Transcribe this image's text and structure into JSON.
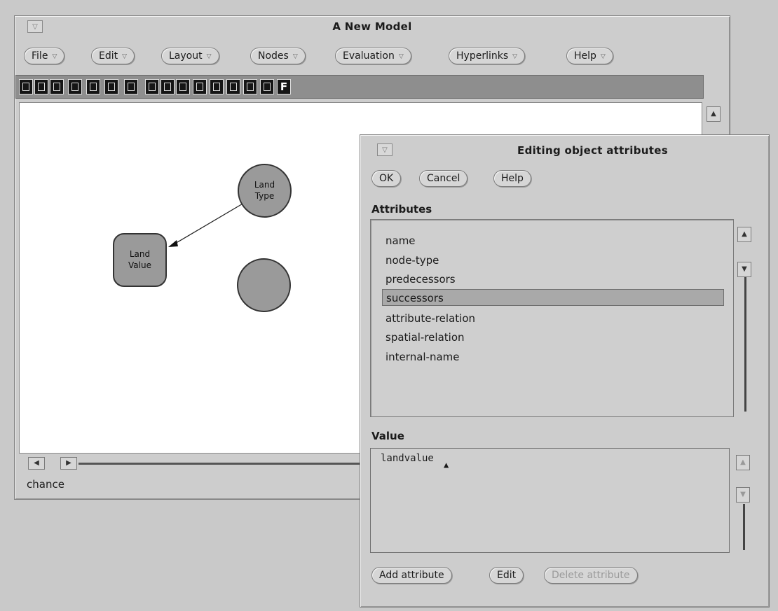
{
  "main_window": {
    "title": "A New Model",
    "menus": [
      {
        "label": "File"
      },
      {
        "label": "Edit"
      },
      {
        "label": "Layout"
      },
      {
        "label": "Nodes"
      },
      {
        "label": "Evaluation"
      },
      {
        "label": "Hyperlinks"
      },
      {
        "label": "Help"
      }
    ],
    "toolbar_tool_count": 16,
    "toolbar_last_label": "F",
    "nodes": [
      {
        "label_line1": "Land",
        "label_line2": "Type",
        "shape": "circle"
      },
      {
        "label_line1": "Land",
        "label_line2": "Value",
        "shape": "rounded-square"
      },
      {
        "label_line1": "",
        "label_line2": "",
        "shape": "circle"
      }
    ],
    "status": "chance"
  },
  "dialog": {
    "title": "Editing object attributes",
    "buttons": {
      "ok": "OK",
      "cancel": "Cancel",
      "help": "Help"
    },
    "attributes_label": "Attributes",
    "attributes": [
      {
        "label": "name"
      },
      {
        "label": "node-type"
      },
      {
        "label": "predecessors"
      },
      {
        "label": "successors",
        "selected": true
      },
      {
        "label": "attribute-relation"
      },
      {
        "label": "spatial-relation"
      },
      {
        "label": "internal-name"
      }
    ],
    "value_label": "Value",
    "value": "landvalue",
    "footer_buttons": {
      "add": "Add attribute",
      "edit": "Edit",
      "delete": "Delete attribute"
    }
  },
  "colors": {
    "background": "#c9c9c9",
    "canvas": "#ffffff",
    "node_fill": "#9a9a9a",
    "selected_row": "#a9a9a9"
  },
  "icons": {
    "menu_arrow": "triangle-down",
    "scroll_up": "triangle-up",
    "scroll_down": "triangle-down"
  }
}
